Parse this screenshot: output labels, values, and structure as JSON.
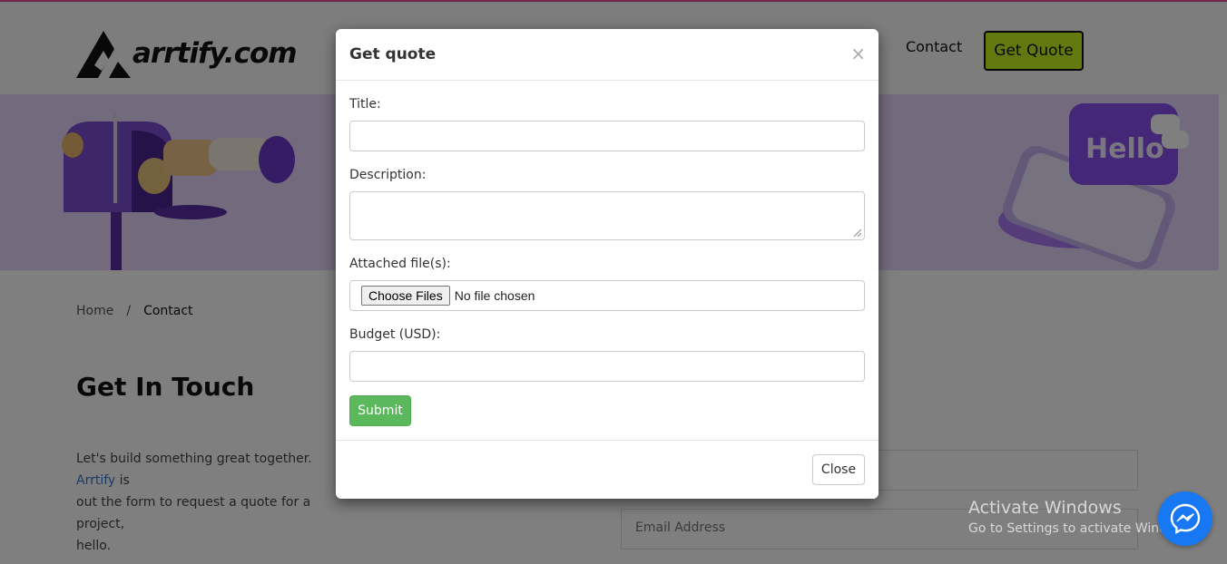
{
  "header": {
    "logo_text": "arrtify.com",
    "nav_contact": "Contact",
    "get_quote": "Get Quote"
  },
  "banner": {
    "bubble_text": "Hello"
  },
  "breadcrumb": {
    "home": "Home",
    "separator": "/",
    "current": "Contact"
  },
  "content": {
    "title": "Get In Touch",
    "text_before": "Let's build something great together.",
    "brand": "Arrtify",
    "text_after": "is",
    "line2": "out the form to request a quote for a project,",
    "line3": "hello.",
    "email_placeholder": "Email Address"
  },
  "watermark": {
    "line1": "Activate Windows",
    "line2": "Go to Settings to activate Windows."
  },
  "modal": {
    "title": "Get quote",
    "close_x": "×",
    "fields": {
      "title_label": "Title:",
      "title_value": "",
      "description_label": "Description:",
      "description_value": "",
      "files_label": "Attached file(s):",
      "files_button": "Choose Files",
      "files_status": "No file chosen",
      "budget_label": "Budget (USD):",
      "budget_value": ""
    },
    "submit": "Submit",
    "close": "Close"
  },
  "colors": {
    "accent_top_line": "#e04d8c",
    "quote_button": "#c8f020",
    "banner": "#e6d7fb",
    "submit": "#5cb85c",
    "messenger": "#1877f2"
  },
  "icons": [
    "logo-mark-icon",
    "mailbox-illustration",
    "phone-hello-illustration",
    "close-icon",
    "messenger-icon"
  ]
}
